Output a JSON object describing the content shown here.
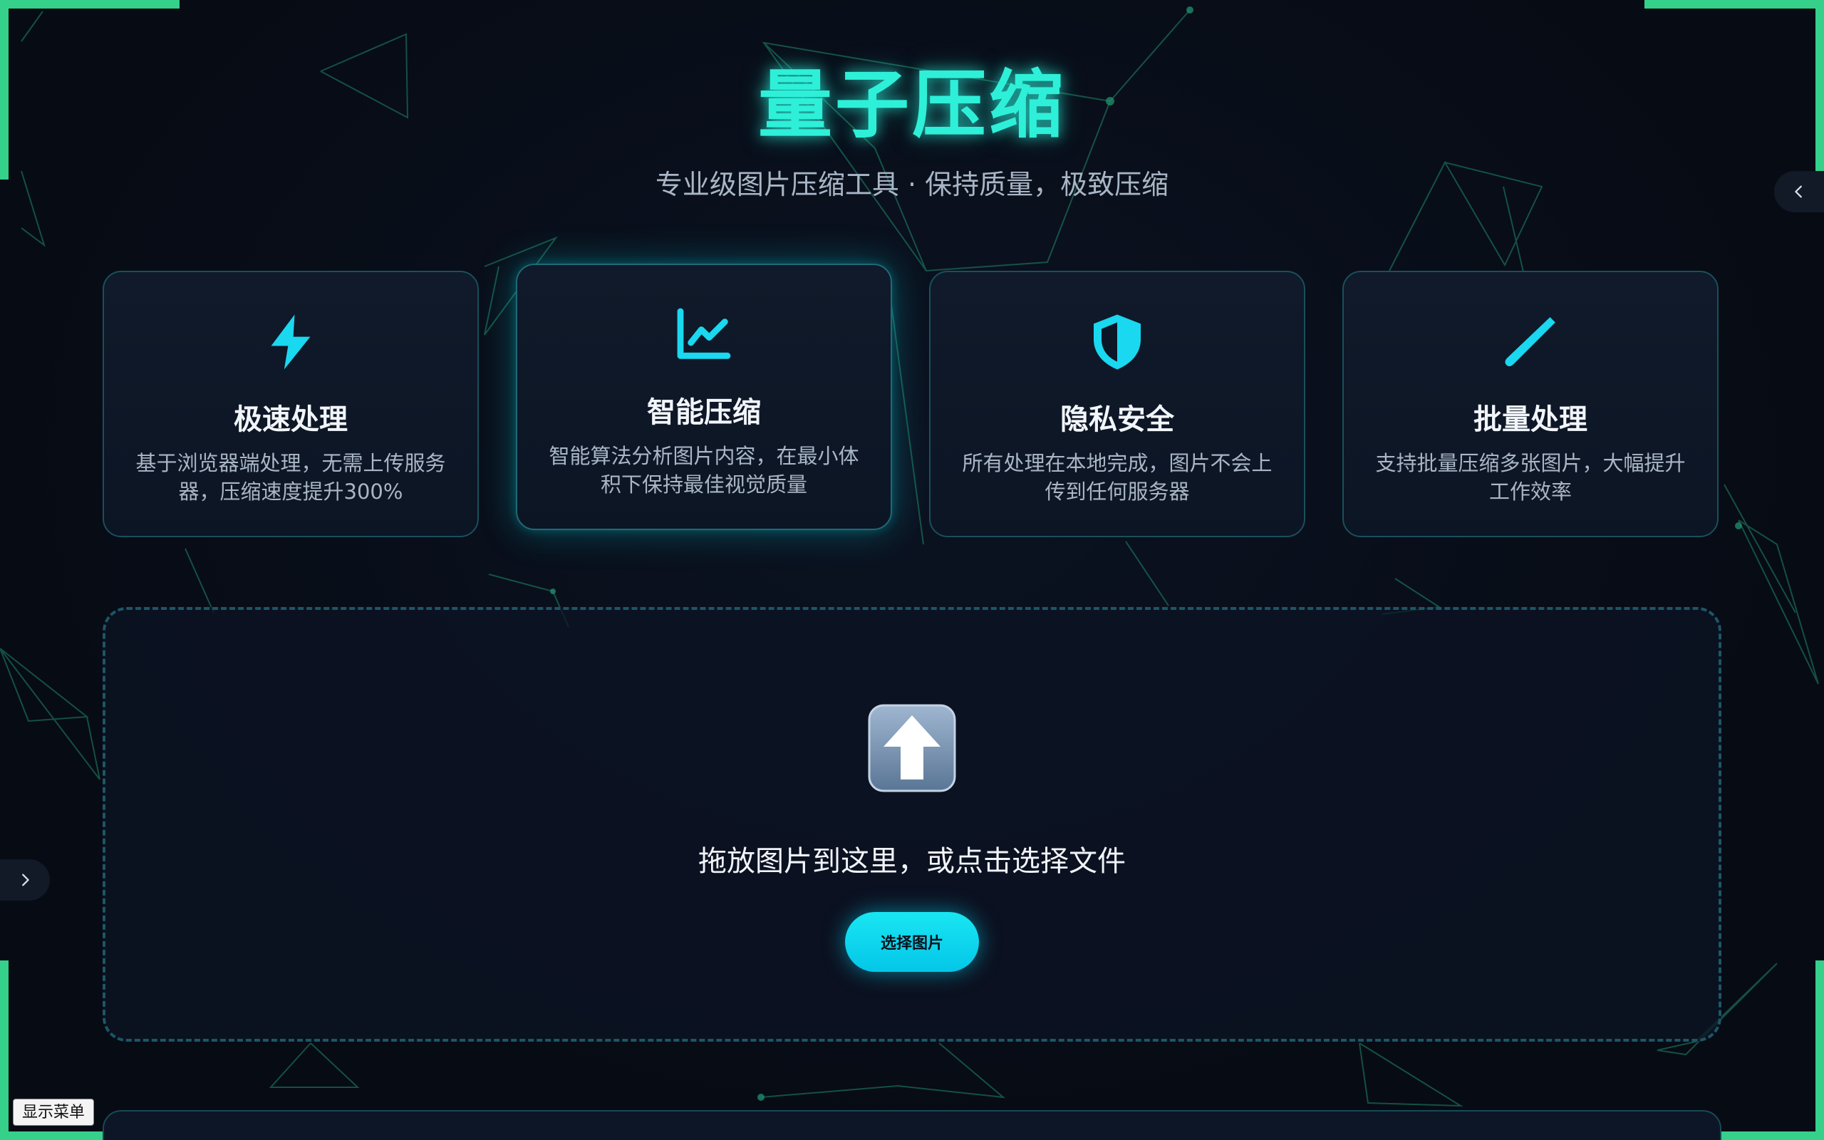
{
  "header": {
    "title": "量子压缩",
    "subtitle": "专业级图片压缩工具 · 保持质量，极致压缩"
  },
  "features": [
    {
      "icon": "lightning-icon",
      "title": "极速处理",
      "desc": "基于浏览器端处理，无需上传服务器，压缩速度提升300%"
    },
    {
      "icon": "chart-line-icon",
      "title": "智能压缩",
      "desc": "智能算法分析图片内容，在最小体积下保持最佳视觉质量"
    },
    {
      "icon": "shield-icon",
      "title": "隐私安全",
      "desc": "所有处理在本地完成，图片不会上传到任何服务器"
    },
    {
      "icon": "pen-icon",
      "title": "批量处理",
      "desc": "支持批量压缩多张图片，大幅提升工作效率"
    }
  ],
  "dropzone": {
    "icon": "upload-arrow-icon",
    "text": "拖放图片到这里，或点击选择文件",
    "button_label": "选择图片"
  },
  "show_menu_label": "显示菜单",
  "colors": {
    "accent": "#2ef0d8",
    "button": "#08d0ee",
    "corner": "#35d08a",
    "background": "#080c16"
  }
}
